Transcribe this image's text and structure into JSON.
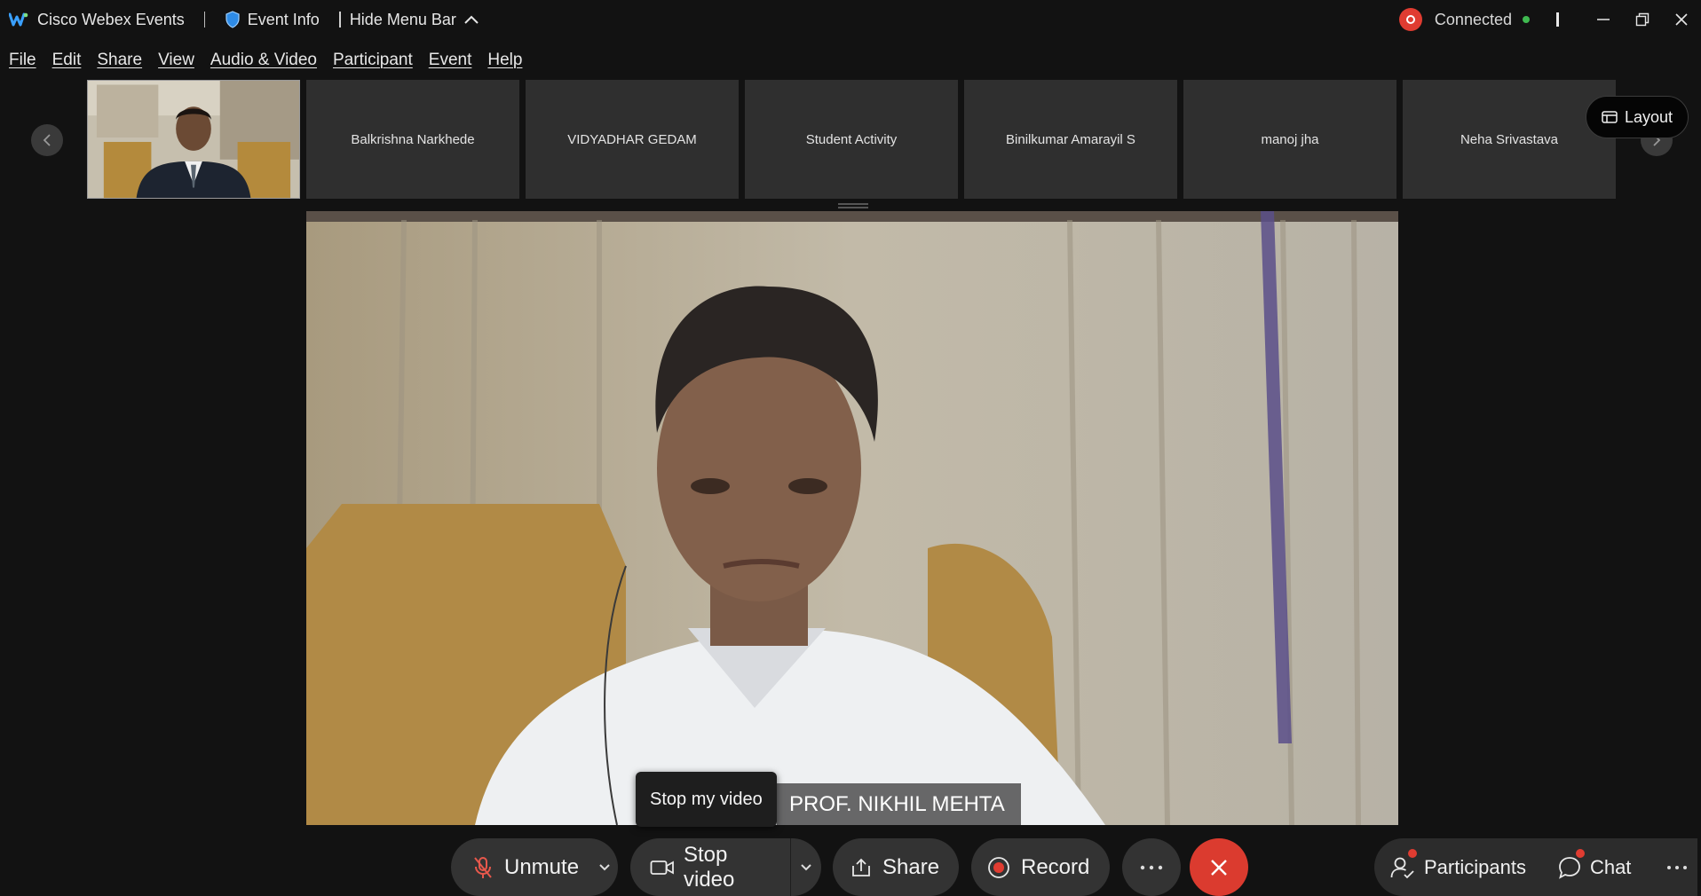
{
  "titlebar": {
    "app_name": "Cisco Webex Events",
    "event_info": "Event Info",
    "hide_menu": "Hide Menu Bar",
    "status": "Connected"
  },
  "menu": [
    "File",
    "Edit",
    "Share",
    "View",
    "Audio & Video",
    "Participant",
    "Event",
    "Help"
  ],
  "filmstrip": {
    "participants": [
      "Balkrishna Narkhede",
      "VIDYADHAR GEDAM",
      "Student Activity",
      "Binilkumar Amarayil S",
      "manoj jha",
      "Neha Srivastava"
    ],
    "layout_label": "Layout"
  },
  "stage": {
    "speaker_name": "PROF. NIKHIL MEHTA",
    "tooltip": "Stop my video"
  },
  "controls": {
    "unmute": "Unmute",
    "stop_video": "Stop video",
    "share": "Share",
    "record": "Record",
    "participants": "Participants",
    "chat": "Chat"
  },
  "colors": {
    "background": "#121212",
    "tile": "#2f2f2f",
    "button": "#333333",
    "end_call": "#db3b2f",
    "connected": "#3fb950",
    "recording": "#e03c31"
  }
}
